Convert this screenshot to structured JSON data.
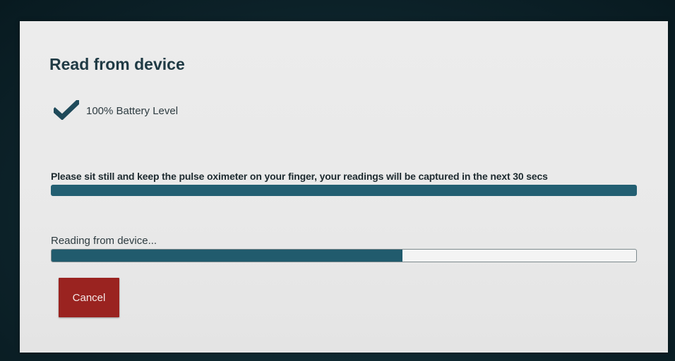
{
  "page": {
    "title": "Read from device"
  },
  "battery": {
    "status_icon": "check-icon",
    "text": "100% Battery Level",
    "icon_color": "#1f4a5a"
  },
  "instruction": {
    "text": "Please sit still and keep the pulse oximeter on your finger, your readings will be captured in the next 30 secs"
  },
  "reading": {
    "label": "Reading from device...",
    "progress_fraction": 0.6
  },
  "actions": {
    "cancel_label": "Cancel"
  },
  "colors": {
    "accent_bar": "#235f72",
    "cancel_button": "#9a2320"
  }
}
